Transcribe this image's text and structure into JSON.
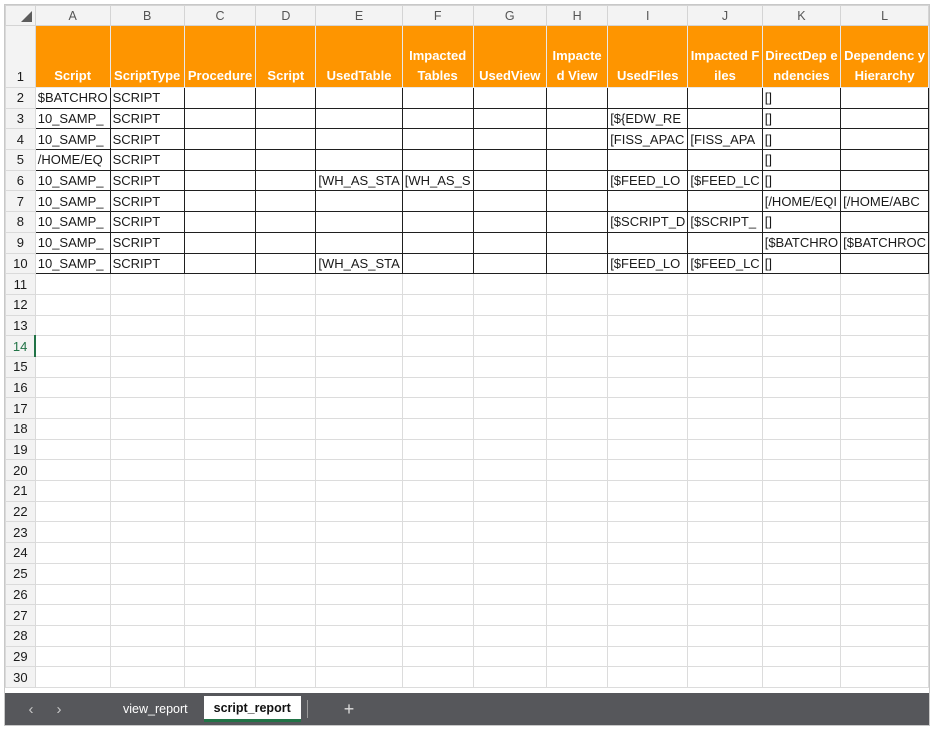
{
  "columns": [
    "A",
    "B",
    "C",
    "D",
    "E",
    "F",
    "G",
    "H",
    "I",
    "J",
    "K",
    "L"
  ],
  "header_cells": [
    "Script",
    "ScriptType",
    "Procedure",
    "Script",
    "UsedTable",
    "Impacted Tables",
    "UsedView",
    "Impacted View",
    "UsedFiles",
    "Impacted Files",
    "DirectDep endencies",
    "Dependenc yHierarchy"
  ],
  "rows": [
    {
      "num": "2",
      "cells": [
        "$BATCHRO",
        "SCRIPT",
        "",
        "",
        "",
        "",
        "",
        "",
        "",
        "",
        "[]",
        ""
      ]
    },
    {
      "num": "3",
      "cells": [
        "10_SAMP_",
        "SCRIPT",
        "",
        "",
        "",
        "",
        "",
        "",
        "[${EDW_RE",
        "",
        "[]",
        ""
      ]
    },
    {
      "num": "4",
      "cells": [
        "10_SAMP_",
        "SCRIPT",
        "",
        "",
        "",
        "",
        "",
        "",
        "[FISS_APAC",
        "[FISS_APA",
        "[]",
        ""
      ]
    },
    {
      "num": "5",
      "cells": [
        "/HOME/EQ",
        "SCRIPT",
        "",
        "",
        "",
        "",
        "",
        "",
        "",
        "",
        "[]",
        ""
      ]
    },
    {
      "num": "6",
      "cells": [
        "10_SAMP_",
        "SCRIPT",
        "",
        "",
        "[WH_AS_STA",
        "[WH_AS_S",
        "",
        "",
        "[$FEED_LO",
        "[$FEED_LC",
        "[]",
        ""
      ]
    },
    {
      "num": "7",
      "cells": [
        "10_SAMP_",
        "SCRIPT",
        "",
        "",
        "",
        "",
        "",
        "",
        "",
        "",
        "[/HOME/EQI",
        "[/HOME/ABC"
      ]
    },
    {
      "num": "8",
      "cells": [
        "10_SAMP_",
        "SCRIPT",
        "",
        "",
        "",
        "",
        "",
        "",
        "[$SCRIPT_D",
        "[$SCRIPT_",
        "[]",
        ""
      ]
    },
    {
      "num": "9",
      "cells": [
        "10_SAMP_",
        "SCRIPT",
        "",
        "",
        "",
        "",
        "",
        "",
        "",
        "",
        "[$BATCHRO",
        "[$BATCHROC"
      ]
    },
    {
      "num": "10",
      "cells": [
        "10_SAMP_",
        "SCRIPT",
        "",
        "",
        "[WH_AS_STA",
        "",
        "",
        "",
        "[$FEED_LO",
        "[$FEED_LC",
        "[]",
        ""
      ]
    }
  ],
  "empty_rows": [
    "11",
    "12",
    "13",
    "14",
    "15",
    "16",
    "17",
    "18",
    "19",
    "20",
    "21",
    "22",
    "23",
    "24",
    "25",
    "26",
    "27",
    "28",
    "29",
    "30"
  ],
  "active_row": "14",
  "tabs": {
    "prev": "‹",
    "next": "›",
    "sheets": [
      "view_report",
      "script_report"
    ],
    "active": "script_report",
    "add": "+"
  },
  "colors": {
    "header_fill": "#fe9500",
    "accent": "#217346"
  }
}
